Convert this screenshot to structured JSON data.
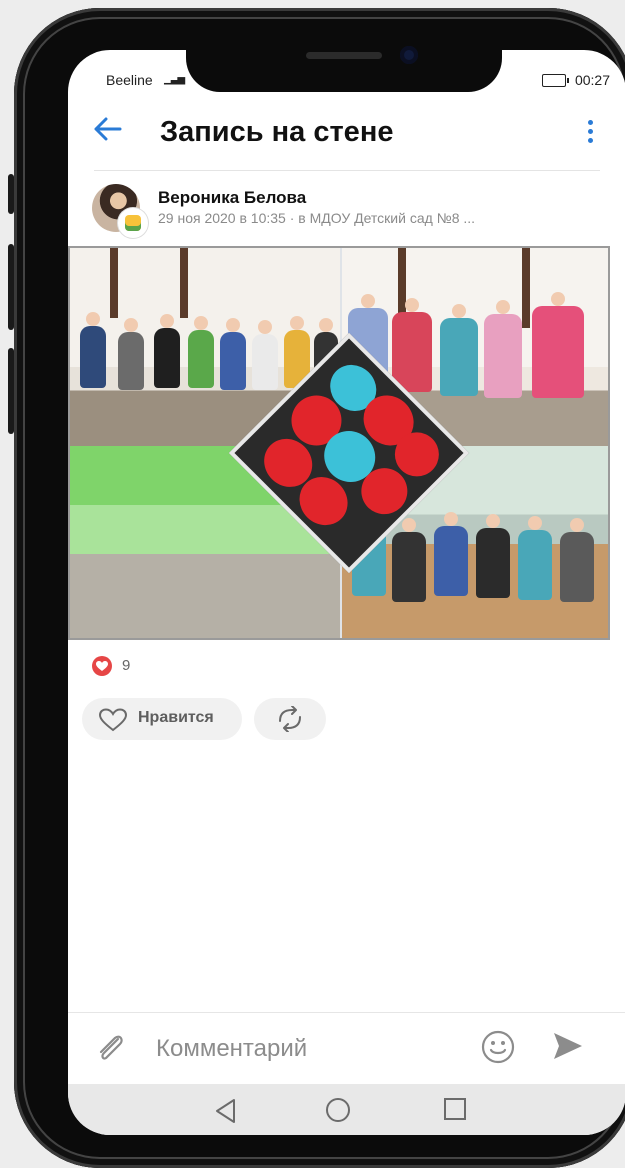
{
  "status": {
    "carrier": "Beeline",
    "time": "00:27"
  },
  "header": {
    "title": "Запись на стене"
  },
  "post": {
    "author_name": "Вероника Белова",
    "meta": "29 ноя 2020 в 10:35 · в МДОУ Детский сад №8 ...",
    "likes_count": "9"
  },
  "actions": {
    "like_label": "Нравится"
  },
  "composer": {
    "placeholder": "Комментарий"
  },
  "colors": {
    "accent": "#2a7bd6",
    "like": "#e64646"
  },
  "icons": [
    "back-arrow-icon",
    "more-vert-icon",
    "heart-icon",
    "repost-icon",
    "attach-icon",
    "emoji-icon",
    "send-icon",
    "nav-back-icon",
    "nav-home-icon",
    "nav-recent-icon"
  ]
}
